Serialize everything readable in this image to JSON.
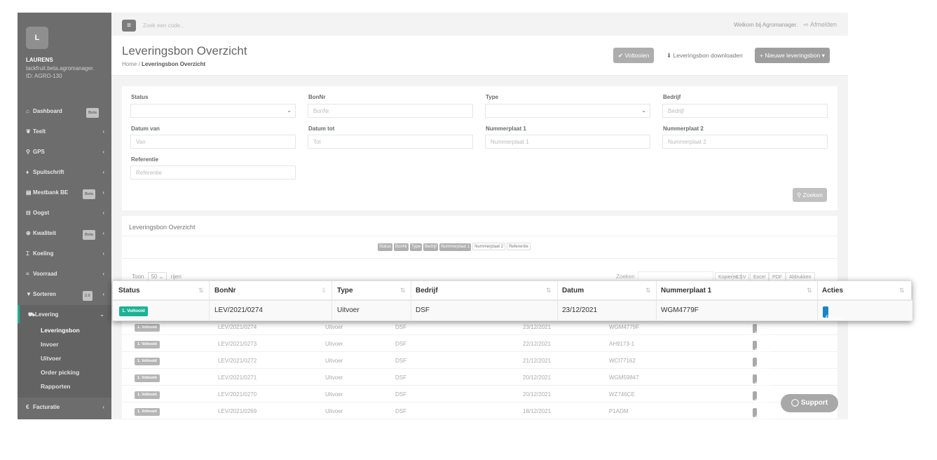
{
  "sidebar": {
    "logo_letter": "L",
    "user_name": "LAURENS",
    "user_host": "tackfruit.beta.agromanager.",
    "user_id": "ID: AGRO-130",
    "items": [
      {
        "icon": "home-icon",
        "glyph": "⌂",
        "label": "Dashboard",
        "badge": "Beta"
      },
      {
        "icon": "leaf-icon",
        "glyph": "❦",
        "label": "Teelt"
      },
      {
        "icon": "map-pin-icon",
        "glyph": "⚲",
        "label": "GPS"
      },
      {
        "icon": "drop-icon",
        "glyph": "♦",
        "label": "Spuitschrift"
      },
      {
        "icon": "book-icon",
        "glyph": "▤",
        "label": "Mestbank BE",
        "badge": "Beta"
      },
      {
        "icon": "basket-icon",
        "glyph": "⊟",
        "label": "Oogst"
      },
      {
        "icon": "lifebuoy-icon",
        "glyph": "⊕",
        "label": "Kwaliteit",
        "badge": "Beta"
      },
      {
        "icon": "thermometer-icon",
        "glyph": "⌶",
        "label": "Koeling"
      },
      {
        "icon": "list-icon",
        "glyph": "≡",
        "label": "Voorraad"
      },
      {
        "icon": "filter-icon",
        "glyph": "▼",
        "label": "Sorteren",
        "badge": "2.0"
      }
    ],
    "active_item": {
      "icon": "truck-icon",
      "glyph": "⛟",
      "label": "Levering"
    },
    "sub_items": [
      "Leveringsbon",
      "Invoer",
      "Uitvoer",
      "Order picking",
      "Rapporten"
    ],
    "last_item": {
      "icon": "euro-icon",
      "glyph": "€",
      "label": "Facturatie"
    }
  },
  "topbar": {
    "search_placeholder": "Zoek een code...",
    "welcome": "Welkom bij Agromanager.",
    "logout": "Afmelden"
  },
  "header": {
    "title": "Leveringsbon Overzicht",
    "crumb_home": "Home",
    "crumb_current": "Leveringsbon Overzicht",
    "btn_voltooien": "✔ Voltooien",
    "btn_download": "⬇ Leveringsbon downloaden",
    "btn_new": "+ Nieuwe leveringsbon ▾"
  },
  "filters": {
    "status_label": "Status",
    "bonnr_label": "BonNr",
    "bonnr_ph": "BonNr",
    "type_label": "Type",
    "bedrijf_label": "Bedrijf",
    "bedrijf_ph": "Bedrijf",
    "datum_van_label": "Datum van",
    "datum_van_ph": "Van",
    "datum_tot_label": "Datum tot",
    "datum_tot_ph": "Tot",
    "np1_label": "Nummerplaat 1",
    "np1_ph": "Nummerplaat 1",
    "np2_label": "Nummerplaat 2",
    "np2_ph": "Nummerplaat 2",
    "ref_label": "Referentie",
    "ref_ph": "Referentie",
    "search_button": "⚲ Zoeken"
  },
  "table_panel": {
    "title": "Leveringsbon Overzicht",
    "column_toggles": [
      "Status",
      "BonNr",
      "Type",
      "Bedrijf",
      "Nummerplaat 1",
      "Nummerplaat 2",
      "Referentie"
    ],
    "toon": "Toon",
    "per_page": "50",
    "rijen": "rijen",
    "zoeken": "Zoeken",
    "export": [
      "Kopieren",
      "CSV",
      "Excel",
      "PDF",
      "Afdrukken"
    ],
    "rows": [
      {
        "status": "1. Voltooid",
        "bonnr": "LEV/2021/0274",
        "type": "Uitvoer",
        "bedrijf": "DSF",
        "datum": "23/12/2021",
        "np1": "WGM4779F",
        "details": "Details"
      },
      {
        "status": "1. Voltooid",
        "bonnr": "LEV/2021/0273",
        "type": "Uitvoer",
        "bedrijf": "DSF",
        "datum": "22/12/2021",
        "np1": "AH9173-1",
        "details": "Details"
      },
      {
        "status": "1. Voltooid",
        "bonnr": "LEV/2021/0272",
        "type": "Uitvoer",
        "bedrijf": "DSF",
        "datum": "21/12/2021",
        "np1": "WCI77162",
        "details": "Details"
      },
      {
        "status": "1. Voltooid",
        "bonnr": "LEV/2021/0271",
        "type": "Uitvoer",
        "bedrijf": "DSF",
        "datum": "20/12/2021",
        "np1": "WGM59847",
        "details": "Details"
      },
      {
        "status": "1. Voltooid",
        "bonnr": "LEV/2021/0270",
        "type": "Uitvoer",
        "bedrijf": "DSF",
        "datum": "20/12/2021",
        "np1": "WZ746CE",
        "details": "Details"
      },
      {
        "status": "1. Voltooid",
        "bonnr": "LEV/2021/0269",
        "type": "Uitvoer",
        "bedrijf": "DSF",
        "datum": "18/12/2021",
        "np1": "P1ADM",
        "details": "Details"
      }
    ]
  },
  "zoom": {
    "headers": [
      "Status",
      "BonNr",
      "Type",
      "Bedrijf",
      "Datum",
      "Nummerplaat 1",
      "Acties"
    ],
    "row": {
      "status": "1. Voltooid",
      "bonnr": "LEV/2021/0274",
      "type": "Uitvoer",
      "bedrijf": "DSF",
      "datum": "23/12/2021",
      "np1": "WGM4779F",
      "details": "Details"
    }
  },
  "support": "Support",
  "colors": {
    "accent": "#1ab394",
    "details_blue": "#1c84c6",
    "sidebar": "#6d6d6d"
  }
}
